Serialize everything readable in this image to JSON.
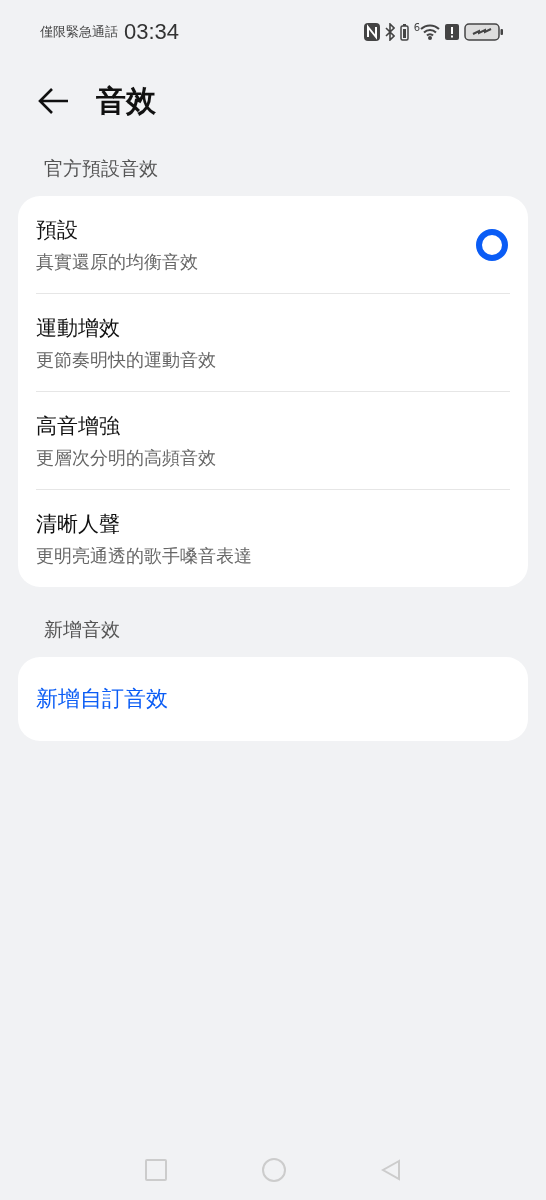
{
  "status_bar": {
    "carrier": "僅限緊急通話",
    "time": "03:34",
    "wifi_badge": "6"
  },
  "header": {
    "title": "音效"
  },
  "sections": [
    {
      "title": "官方預設音效",
      "items": [
        {
          "kind": "option",
          "title": "預設",
          "subtitle": "真實還原的均衡音效",
          "selected": true
        },
        {
          "kind": "option",
          "title": "運動增效",
          "subtitle": "更節奏明快的運動音效",
          "selected": false
        },
        {
          "kind": "option",
          "title": "高音增強",
          "subtitle": "更層次分明的高頻音效",
          "selected": false
        },
        {
          "kind": "option",
          "title": "清晰人聲",
          "subtitle": "更明亮通透的歌手嗓音表達",
          "selected": false
        }
      ]
    },
    {
      "title": "新增音效",
      "items": [
        {
          "kind": "action",
          "title": "新增自訂音效"
        }
      ]
    }
  ]
}
